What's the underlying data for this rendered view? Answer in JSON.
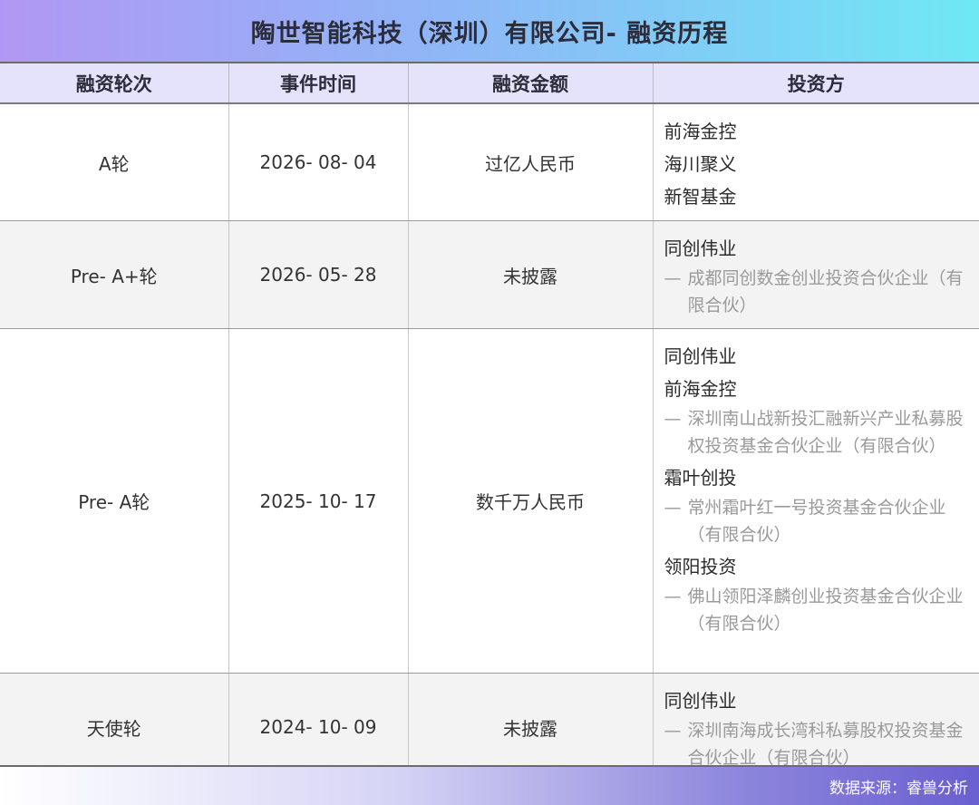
{
  "title": "陶世智能科技（深圳）有限公司- 融资历程",
  "headers": {
    "round": "融资轮次",
    "date": "事件时间",
    "amount": "融资金额",
    "investors": "投资方"
  },
  "rows": [
    {
      "round": "A轮",
      "date": "2026- 08- 04",
      "amount": "过亿人民币",
      "investors": [
        {
          "name": "前海金控"
        },
        {
          "name": "海川聚义"
        },
        {
          "name": "新智基金"
        }
      ]
    },
    {
      "round": "Pre- A+轮",
      "date": "2026- 05- 28",
      "amount": "未披露",
      "investors": [
        {
          "name": "同创伟业",
          "detail": "成都同创数金创业投资合伙企业（有限合伙）"
        }
      ]
    },
    {
      "round": "Pre- A轮",
      "date": "2025- 10- 17",
      "amount": "数千万人民币",
      "investors": [
        {
          "name": "同创伟业"
        },
        {
          "name": "前海金控",
          "detail": "深圳南山战新投汇融新兴产业私募股权投资基金合伙企业（有限合伙）"
        },
        {
          "name": "霜叶创投",
          "detail": "常州霜叶红一号投资基金合伙企业（有限合伙）"
        },
        {
          "name": "领阳投资",
          "detail": "佛山领阳泽麟创业投资基金合伙企业（有限合伙）"
        }
      ]
    },
    {
      "round": "天使轮",
      "date": "2024- 10- 09",
      "amount": "未披露",
      "investors": [
        {
          "name": "同创伟业",
          "detail": "深圳南海成长湾科私募股权投资基金合伙企业（有限合伙）"
        }
      ]
    }
  ],
  "dash": "—",
  "footer": "数据来源：睿兽分析"
}
